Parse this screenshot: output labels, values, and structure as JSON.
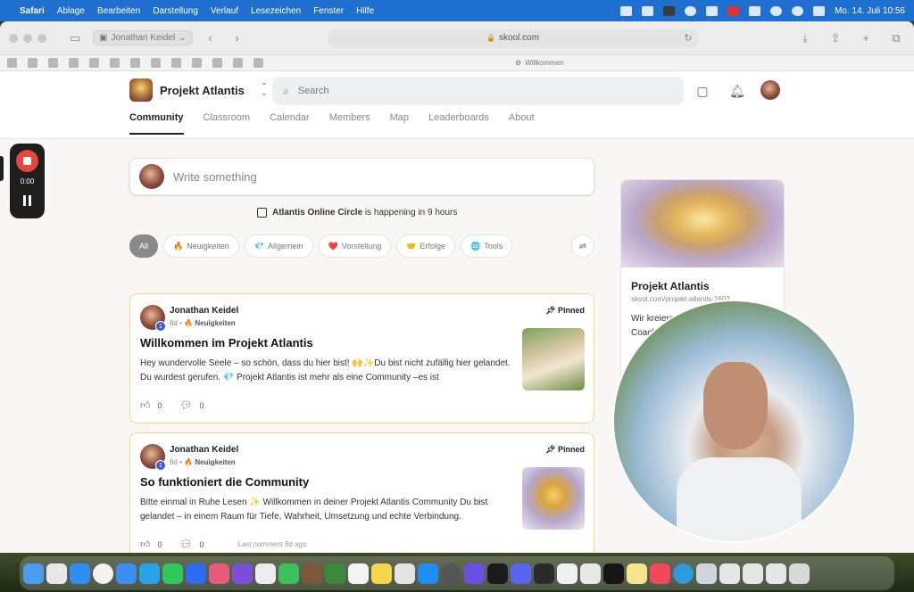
{
  "menubar": {
    "app": "Safari",
    "items": [
      "Ablage",
      "Bearbeiten",
      "Darstellung",
      "Verlauf",
      "Lesezeichen",
      "Fenster",
      "Hilfe"
    ],
    "clock": "Mo. 14. Juli  10:56"
  },
  "browser": {
    "profile": "Jonathan Keidel",
    "url": "skool.com",
    "tab_title": "Willkommen"
  },
  "header": {
    "group_name": "Projekt Atlantis",
    "search_placeholder": "Search",
    "nav": [
      "Community",
      "Classroom",
      "Calendar",
      "Members",
      "Map",
      "Leaderboards",
      "About"
    ]
  },
  "composer": {
    "placeholder": "Write something"
  },
  "event": {
    "name": "Atlantis Online Circle",
    "suffix": "is happening in 9 hours"
  },
  "filters": [
    {
      "icon": "",
      "label": "All"
    },
    {
      "icon": "🔥",
      "label": "Neuigkeiten"
    },
    {
      "icon": "💎",
      "label": "Allgemein"
    },
    {
      "icon": "❤️",
      "label": "Vorstellung"
    },
    {
      "icon": "🤝",
      "label": "Erfolge"
    },
    {
      "icon": "🌐",
      "label": "Tools"
    }
  ],
  "posts": [
    {
      "author": "Jonathan Keidel",
      "level": "1",
      "age": "8d •",
      "category": "🔥 Neuigkeiten",
      "pinned": "Pinned",
      "title": "Willkommen im Projekt Atlantis",
      "body": "Hey wundervolle Seele – so schön, dass du hier bist! 🙌✨Du bist nicht zufällig hier gelandet. Du wurdest gerufen. 💎 Projekt Atlantis ist mehr als eine Community –es ist",
      "likes": "0",
      "comments": "0",
      "last_comment": ""
    },
    {
      "author": "Jonathan Keidel",
      "level": "1",
      "age": "8d •",
      "category": "🔥 Neuigkeiten",
      "pinned": "Pinned",
      "title": "So funktioniert die Community",
      "body": "Bitte einmal in Ruhe Lesen ✨ Willkommen in deiner Projekt Atlantis Community Du bist gelandet – in einem Raum für Tiefe, Wahrheit, Umsetzung und echte Verbindung.",
      "likes": "0",
      "comments": "0",
      "last_comment": "Last comment 8d ago"
    }
  ],
  "sidebar": {
    "title": "Projekt Atlantis",
    "url": "skool.com/projekt-atlantis-1602",
    "description": "Wir kreieren eine autarke online Coaching & ... der jed... örtl..."
  },
  "recorder": {
    "time": "0:00"
  },
  "colors": {
    "accent": "#f3d58a",
    "menubar": "#1f6fd1",
    "record": "#e5483b"
  }
}
